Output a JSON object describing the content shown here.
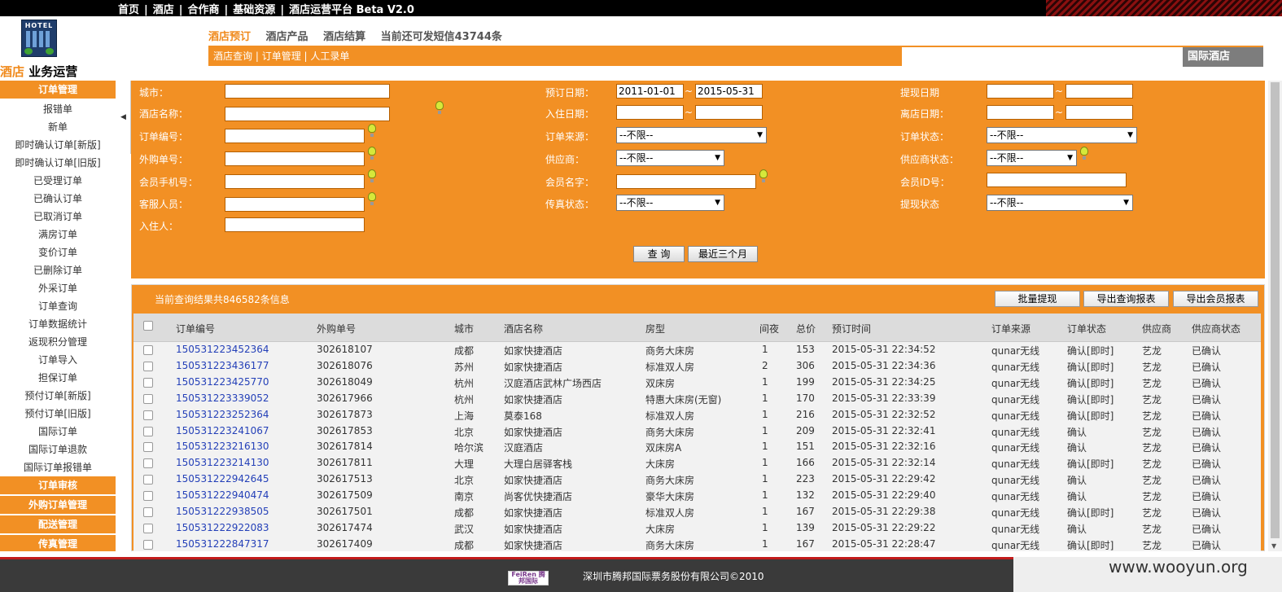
{
  "topnav": {
    "items": [
      "首页",
      "酒店",
      "合作商",
      "基础资源",
      "酒店运营平台 Beta V2.0"
    ]
  },
  "logo": {
    "text": "HOTEL"
  },
  "brand": {
    "part1": "酒店",
    "part2": " 业务运营"
  },
  "maintabs": [
    "酒店预订",
    "酒店产品",
    "酒店结算",
    "当前还可发短信43744条"
  ],
  "subnav": {
    "items": [
      "酒店查询",
      "订单管理",
      "人工录单"
    ]
  },
  "intl_label": "国际酒店",
  "sidebar": {
    "head": "订单管理",
    "items": [
      "报错单",
      "新单",
      "即时确认订单[新版]",
      "即时确认订单[旧版]",
      "已受理订单",
      "已确认订单",
      "已取消订单",
      "满房订单",
      "变价订单",
      "已删除订单",
      "外采订单",
      "订单查询",
      "订单数据统计",
      "返现积分管理",
      "订单导入",
      "担保订单",
      "预付订单[新版]",
      "预付订单[旧版]",
      "国际订单",
      "国际订单退款",
      "国际订单报错单"
    ],
    "sections": [
      "订单审核",
      "外购订单管理",
      "配送管理",
      "传真管理"
    ]
  },
  "search": {
    "city_label": "城市：",
    "hotel_label": "酒店名称：",
    "order_no_label": "订单编号：",
    "ext_no_label": "外购单号：",
    "phone_label": "会员手机号：",
    "cs_label": "客服人员：",
    "guest_label": "入住人：",
    "book_date_label": "预订日期：",
    "book_date_from": "2011-01-01",
    "book_date_to": "2015-05-31",
    "checkin_label": "入住日期：",
    "source_label": "订单来源：",
    "source_value": "--不限--",
    "supplier_label": "供应商：",
    "supplier_value": "--不限--",
    "member_name_label": "会员名字：",
    "fax_label": "传真状态：",
    "fax_value": "--不限--",
    "cashout_date_label": "提现日期",
    "checkout_label": "离店日期：",
    "order_status_label": "订单状态：",
    "order_status_value": "--不限--",
    "supplier_status_label": "供应商状态：",
    "supplier_status_value": "--不限--",
    "member_id_label": "会员ID号：",
    "cashout_status_label": "提现状态",
    "cashout_status_value": "--不限--",
    "tilde": "~",
    "query_btn": "查 询",
    "recent_btn": "最近三个月"
  },
  "results": {
    "info": "当前查询结果共846582条信息",
    "buttons": [
      "批量提现",
      "导出查询报表",
      "导出会员报表"
    ],
    "headers": [
      "订单编号",
      "外购单号",
      "城市",
      "酒店名称",
      "房型",
      "间夜",
      "总价",
      "预订时间",
      "订单来源",
      "订单状态",
      "供应商",
      "供应商状态"
    ],
    "rows": [
      [
        "150531223452364",
        "302618107",
        "成都",
        "如家快捷酒店",
        "商务大床房",
        "1",
        "153",
        "2015-05-31 22:34:52",
        "qunar无线",
        "确认[即时]",
        "艺龙",
        "已确认"
      ],
      [
        "150531223436177",
        "302618076",
        "苏州",
        "如家快捷酒店",
        "标准双人房",
        "2",
        "306",
        "2015-05-31 22:34:36",
        "qunar无线",
        "确认[即时]",
        "艺龙",
        "已确认"
      ],
      [
        "150531223425770",
        "302618049",
        "杭州",
        "汉庭酒店武林广场西店",
        "双床房",
        "1",
        "199",
        "2015-05-31 22:34:25",
        "qunar无线",
        "确认[即时]",
        "艺龙",
        "已确认"
      ],
      [
        "150531223339052",
        "302617966",
        "杭州",
        "如家快捷酒店",
        "特惠大床房(无窗)",
        "1",
        "170",
        "2015-05-31 22:33:39",
        "qunar无线",
        "确认[即时]",
        "艺龙",
        "已确认"
      ],
      [
        "150531223252364",
        "302617873",
        "上海",
        "莫泰168",
        "标准双人房",
        "1",
        "216",
        "2015-05-31 22:32:52",
        "qunar无线",
        "确认[即时]",
        "艺龙",
        "已确认"
      ],
      [
        "150531223241067",
        "302617853",
        "北京",
        "如家快捷酒店",
        "商务大床房",
        "1",
        "209",
        "2015-05-31 22:32:41",
        "qunar无线",
        "确认",
        "艺龙",
        "已确认"
      ],
      [
        "150531223216130",
        "302617814",
        "哈尔滨",
        "汉庭酒店",
        "双床房A",
        "1",
        "151",
        "2015-05-31 22:32:16",
        "qunar无线",
        "确认",
        "艺龙",
        "已确认"
      ],
      [
        "150531223214130",
        "302617811",
        "大理",
        "大理白居驿客栈",
        "大床房",
        "1",
        "166",
        "2015-05-31 22:32:14",
        "qunar无线",
        "确认[即时]",
        "艺龙",
        "已确认"
      ],
      [
        "150531222942645",
        "302617513",
        "北京",
        "如家快捷酒店",
        "商务大床房",
        "1",
        "223",
        "2015-05-31 22:29:42",
        "qunar无线",
        "确认",
        "艺龙",
        "已确认"
      ],
      [
        "150531222940474",
        "302617509",
        "南京",
        "尚客优快捷酒店",
        "豪华大床房",
        "1",
        "132",
        "2015-05-31 22:29:40",
        "qunar无线",
        "确认",
        "艺龙",
        "已确认"
      ],
      [
        "150531222938505",
        "302617501",
        "成都",
        "如家快捷酒店",
        "标准双人房",
        "1",
        "167",
        "2015-05-31 22:29:38",
        "qunar无线",
        "确认[即时]",
        "艺龙",
        "已确认"
      ],
      [
        "150531222922083",
        "302617474",
        "武汉",
        "如家快捷酒店",
        "大床房",
        "1",
        "139",
        "2015-05-31 22:29:22",
        "qunar无线",
        "确认",
        "艺龙",
        "已确认"
      ],
      [
        "150531222847317",
        "302617409",
        "成都",
        "如家快捷酒店",
        "商务大床房",
        "1",
        "167",
        "2015-05-31 22:28:47",
        "qunar无线",
        "确认[即时]",
        "艺龙",
        "已确认"
      ]
    ]
  },
  "footer": {
    "logo_text": "FeiRen 腾邦国际",
    "copyright": "深圳市腾邦国际票务股份有限公司©2010"
  },
  "watermark": "www.wooyun.org",
  "colors": {
    "accent": "#f29024",
    "link": "#2440b8",
    "dark": "#000000"
  }
}
